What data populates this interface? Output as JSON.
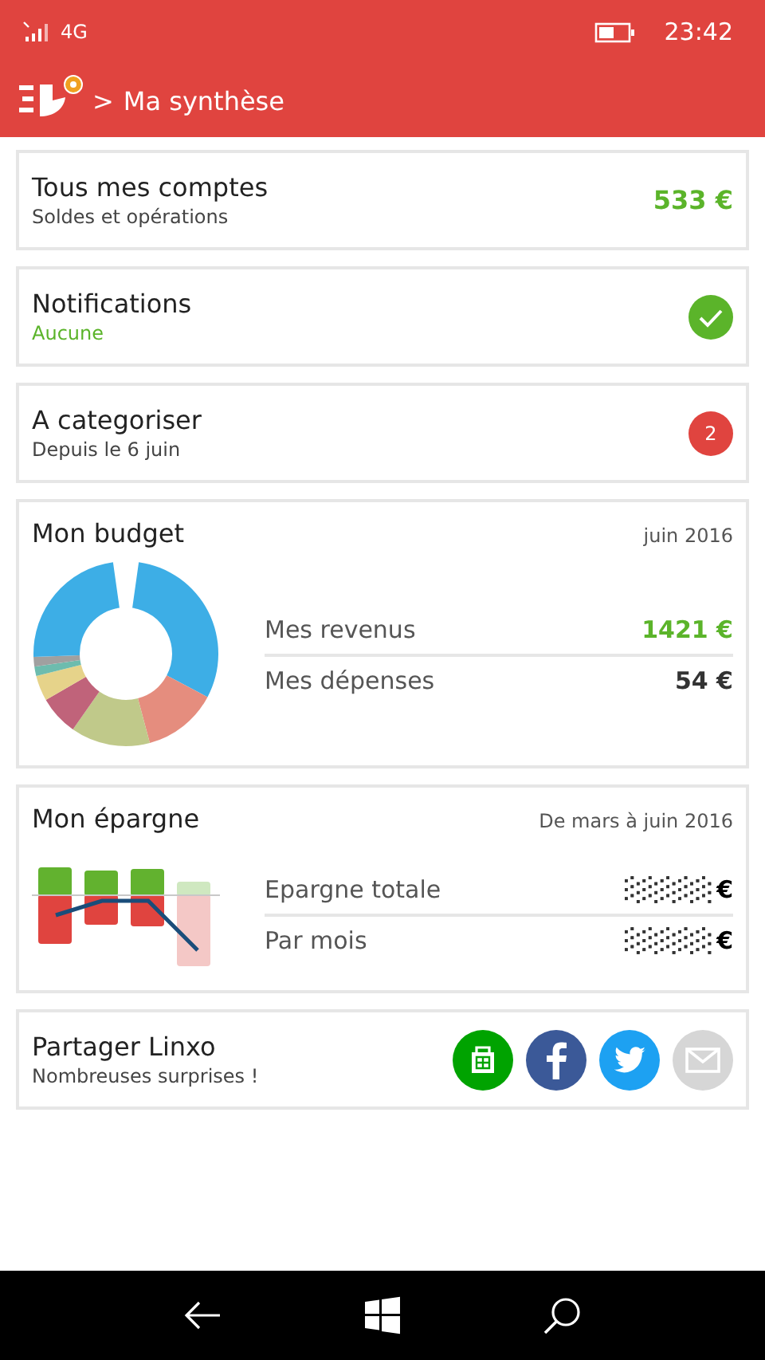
{
  "status_bar": {
    "network": "4G",
    "time": "23:42"
  },
  "header": {
    "separator": ">",
    "title": "Ma synthèse"
  },
  "accounts": {
    "title": "Tous mes comptes",
    "subtitle": "Soldes et opérations",
    "amount": "533 €"
  },
  "notifications": {
    "title": "Notifications",
    "subtitle": "Aucune",
    "all_clear": true
  },
  "categorize": {
    "title": "A categoriser",
    "subtitle": "Depuis le 6 juin",
    "count": "2"
  },
  "budget": {
    "title": "Mon budget",
    "period": "juin 2016",
    "rows": [
      {
        "label": "Mes revenus",
        "value": "1421 €",
        "kind": "income"
      },
      {
        "label": "Mes dépenses",
        "value": "54 €",
        "kind": "expense"
      }
    ]
  },
  "savings": {
    "title": "Mon épargne",
    "period": "De mars à juin 2016",
    "rows": [
      {
        "label": "Epargne totale",
        "currency": "€"
      },
      {
        "label": "Par mois",
        "currency": "€"
      }
    ]
  },
  "share": {
    "title": "Partager Linxo",
    "subtitle": "Nombreuses surprises !",
    "targets": [
      {
        "kind": "store",
        "color": "#00a300"
      },
      {
        "kind": "facebook",
        "color": "#3b5998"
      },
      {
        "kind": "twitter",
        "color": "#1da1f2"
      },
      {
        "kind": "mail",
        "color": "#d6d6d6"
      }
    ]
  }
}
